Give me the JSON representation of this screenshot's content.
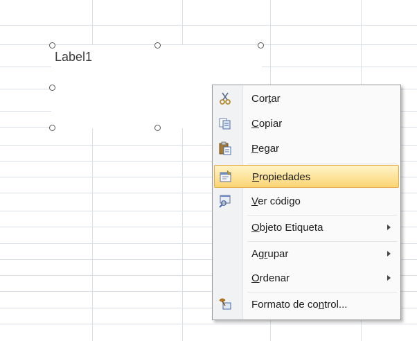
{
  "label_control": {
    "text": "Label1"
  },
  "context_menu": {
    "items": [
      {
        "id": "cut",
        "pre": "Cor",
        "u": "t",
        "post": "ar",
        "icon": "scissors-icon",
        "submenu": false
      },
      {
        "id": "copy",
        "pre": "",
        "u": "C",
        "post": "opiar",
        "icon": "copy-icon",
        "submenu": false
      },
      {
        "id": "paste",
        "pre": "",
        "u": "P",
        "post": "egar",
        "icon": "paste-icon",
        "submenu": false
      },
      {
        "id": "properties",
        "pre": "",
        "u": "P",
        "post": "ropiedades",
        "icon": "properties-icon",
        "submenu": false,
        "highlighted": true
      },
      {
        "id": "view-code",
        "pre": "",
        "u": "V",
        "post": "er código",
        "icon": "view-code-icon",
        "submenu": false
      },
      {
        "id": "label-object",
        "pre": "",
        "u": "O",
        "post": "bjeto Etiqueta",
        "icon": "",
        "submenu": true
      },
      {
        "id": "group",
        "pre": "Ag",
        "u": "r",
        "post": "upar",
        "icon": "",
        "submenu": true
      },
      {
        "id": "order",
        "pre": "",
        "u": "O",
        "post": "rdenar",
        "icon": "",
        "submenu": true
      },
      {
        "id": "format-control",
        "pre": "Formato de co",
        "u": "n",
        "post": "trol...",
        "icon": "format-control-icon",
        "submenu": false
      }
    ]
  },
  "colors": {
    "highlight_top": "#fff3c8",
    "highlight_bottom": "#fbd575",
    "highlight_border": "#e3ad4a",
    "gridline": "#dadfe6"
  }
}
